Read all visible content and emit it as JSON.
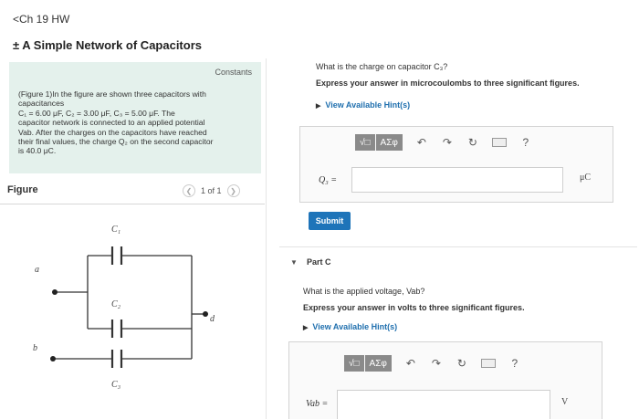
{
  "header": {
    "back_label": "<Ch 19 HW",
    "title": "± A Simple Network of Capacitors"
  },
  "constants": {
    "label": "Constants",
    "text_lines": [
      "(Figure 1)In the figure are shown three capacitors with",
      "capacitances",
      "C₁ = 6.00 μF, C₂ = 3.00 μF, C₃ = 5.00 μF. The",
      "capacitor network is connected to an applied potential",
      "Vab. After the charges on the capacitors have reached",
      "their final values, the charge Q₂ on the second capacitor",
      "is 40.0 μC."
    ]
  },
  "figure": {
    "label": "Figure",
    "pager_text": "1 of 1",
    "prev_icon": "chevron-left-icon",
    "next_icon": "chevron-right-icon",
    "labels": {
      "c1": "C₁",
      "c2": "C₂",
      "c3": "C₃",
      "a": "a",
      "b": "b",
      "d": "d"
    }
  },
  "part_b": {
    "question": "What is the charge on capacitor C₃?",
    "instruction": "Express your answer in microcoulombs to three significant figures.",
    "hint_label": "View Available Hint(s)",
    "toolbar": {
      "template_label": "√□",
      "greek_label": "ΑΣφ",
      "help_label": "?"
    },
    "variable_label": "Q₃ =",
    "unit": "μC",
    "answer_value": "",
    "submit_label": "Submit"
  },
  "part_c": {
    "label": "Part C",
    "question": "What is the applied voltage, Vab?",
    "instruction": "Express your answer in volts to three significant figures.",
    "hint_label": "View Available Hint(s)",
    "toolbar": {
      "template_label": "√□",
      "greek_label": "ΑΣφ",
      "help_label": "?"
    },
    "variable_label": "Vab =",
    "unit": "V",
    "answer_value": ""
  },
  "colors": {
    "accent": "#1e74b9",
    "panel_bg": "#e4f1ec",
    "toolbar_btn": "#8a8a8a"
  }
}
